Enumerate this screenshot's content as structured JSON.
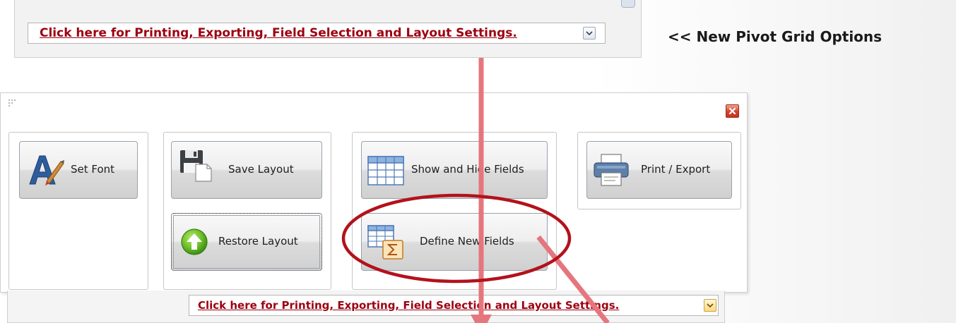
{
  "top_bar": {
    "link_text": "Click here for Printing, Exporting, Field Selection and Layout Settings.",
    "dropdown_icon": "chevron-down-icon"
  },
  "annotation": {
    "text": "<< New Pivot Grid Options"
  },
  "options_panel": {
    "close_icon": "close-icon",
    "grip_icon": "grip-icon",
    "buttons": {
      "set_font": {
        "label": "Set Font",
        "icon": "font-icon"
      },
      "save_layout": {
        "label": "Save Layout",
        "icon": "save-icon"
      },
      "restore_layout": {
        "label": "Restore Layout",
        "icon": "restore-icon"
      },
      "show_hide_fields": {
        "label": "Show and Hide Fields",
        "icon": "grid-icon"
      },
      "define_new_fields": {
        "label": "Define New Fields",
        "icon": "sum-field-icon"
      },
      "print_export": {
        "label": "Print / Export",
        "icon": "printer-icon"
      }
    }
  },
  "bottom_bar": {
    "link_text": "Click here for Printing, Exporting, Field Selection and Layout Settings.",
    "dropdown_icon": "chevron-down-icon"
  },
  "colors": {
    "link": "#9c0010",
    "arrow": "#e5767d",
    "highlight_ellipse": "#b3121c",
    "close_button": "#d6422c"
  }
}
